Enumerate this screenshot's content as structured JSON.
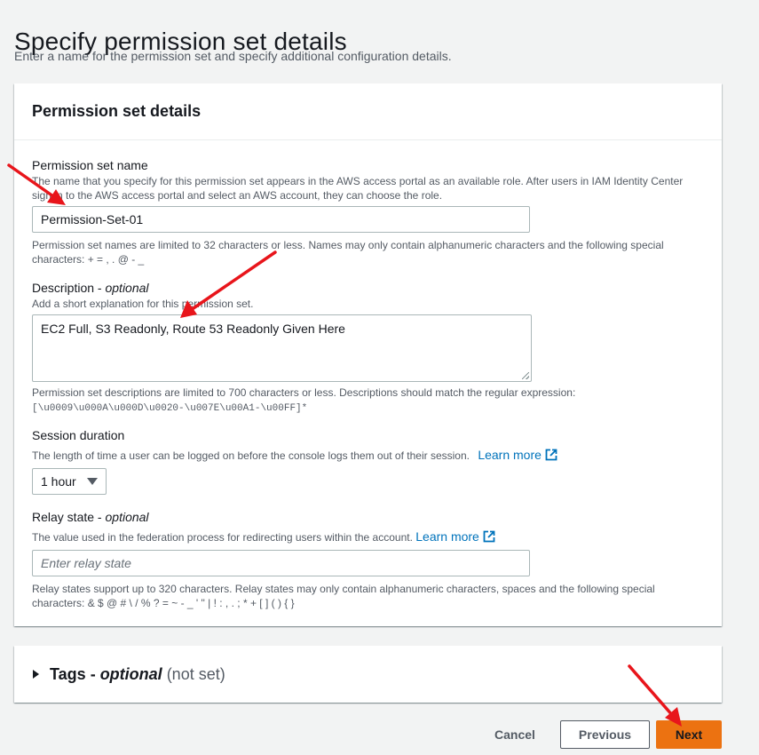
{
  "page": {
    "title": "Specify permission set details",
    "description": "Enter a name for the permission set and specify additional configuration details."
  },
  "details_panel": {
    "header": "Permission set details",
    "name_field": {
      "label": "Permission set name",
      "hint": "The name that you specify for this permission set appears in the AWS access portal as an available role. After users in IAM Identity Center sign in to the AWS access portal and select an AWS account, they can choose the role.",
      "value": "Permission-Set-01",
      "constraint": "Permission set names are limited to 32 characters or less. Names may only contain alphanumeric characters and the following special characters: + = , . @ - _"
    },
    "description_field": {
      "label": "Description",
      "label_suffix": "optional",
      "hint": "Add a short explanation for this permission set.",
      "value": "EC2 Full, S3 Readonly, Route 53 Readonly Given Here",
      "constraint": "Permission set descriptions are limited to 700 characters or less. Descriptions should match the regular expression:",
      "regex": "[\\u0009\\u000A\\u000D\\u0020-\\u007E\\u00A1-\\u00FF]*"
    },
    "session_field": {
      "label": "Session duration",
      "hint": "The length of time a user can be logged on before the console logs them out of their session.",
      "link": "Learn more",
      "selected": "1 hour"
    },
    "relay_field": {
      "label": "Relay state",
      "label_suffix": "optional",
      "hint": "The value used in the federation process for redirecting users within the account.",
      "link": "Learn more",
      "placeholder": "Enter relay state",
      "constraint": "Relay states support up to 320 characters. Relay states may only contain alphanumeric characters, spaces and the following special characters: & $ @ # \\ / % ? = ~ - _ ' \" | ! : , . ; * + [ ] ( ) { }"
    }
  },
  "tags_panel": {
    "title": "Tags",
    "title_suffix": "optional",
    "status": "(not set)"
  },
  "footer": {
    "cancel": "Cancel",
    "previous": "Previous",
    "next": "Next"
  },
  "colors": {
    "background": "#f2f3f3",
    "link": "#0073bb",
    "primary_button": "#ec7211",
    "annotation_arrow": "#e8151b"
  },
  "icons": [
    "external-link-icon",
    "caret-down-icon",
    "expand-triangle-icon",
    "red-arrow-annotation"
  ]
}
